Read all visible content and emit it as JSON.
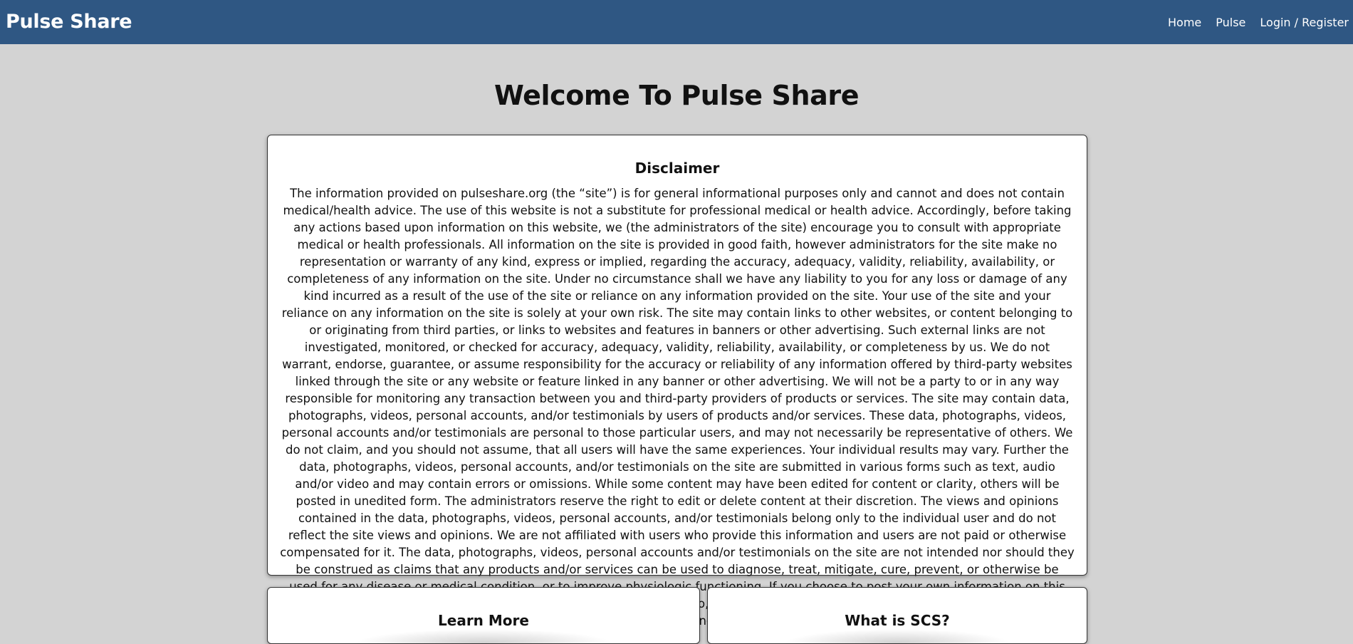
{
  "navbar": {
    "brand": "Pulse Share",
    "links": [
      "Home",
      "Pulse",
      "Login / Register"
    ]
  },
  "page": {
    "title": "Welcome To Pulse Share"
  },
  "disclaimer": {
    "heading": "Disclaimer",
    "body": "The information provided on pulseshare.org (the “site”) is for general informational purposes only and cannot and does not contain medical/health advice. The use of this website is not a substitute for professional medical or health advice. Accordingly, before taking any actions based upon information on this website, we (the administrators of the site) encourage you to consult with appropriate medical or health professionals. All information on the site is provided in good faith, however administrators for the site make no representation or warranty of any kind, express or implied, regarding the accuracy, adequacy, validity, reliability, availability, or completeness of any information on the site. Under no circumstance shall we have any liability to you for any loss or damage of any kind incurred as a result of the use of the site or reliance on any information provided on the site. Your use of the site and your reliance on any information on the site is solely at your own risk. The site may contain links to other websites, or content belonging to or originating from third parties, or links to websites and features in banners or other advertising. Such external links are not investigated, monitored, or checked for accuracy, adequacy, validity, reliability, availability, or completeness by us. We do not warrant, endorse, guarantee, or assume responsibility for the accuracy or reliability of any information offered by third-party websites linked through the site or any website or feature linked in any banner or other advertising. We will not be a party to or in any way responsible for monitoring any transaction between you and third-party providers of products or services. The site may contain data, photographs, videos, personal accounts, and/or testimonials by users of products and/or services. These data, photographs, videos, personal accounts and/or testimonials are personal to those particular users, and may not necessarily be representative of others. We do not claim, and you should not assume, that all users will have the same experiences. Your individual results may vary. Further the data, photographs, videos, personal accounts, and/or testimonials on the site are submitted in various forms such as text, audio and/or video and may contain errors or omissions. While some content may have been edited for content or clarity, others will be posted in unedited form. The administrators reserve the right to edit or delete content at their discretion. The views and opinions contained in the data, photographs, videos, personal accounts, and/or testimonials belong only to the individual user and do not reflect the site views and opinions. We are not affiliated with users who provide this information and users are not paid or otherwise compensated for it. The data, photographs, videos, personal accounts and/or testimonials on the site are not intended nor should they be construed as claims that any products and/or services can be used to diagnose, treat, mitigate, cure, prevent, or otherwise be used for any disease or medical condition, or to improve physiologic functioning. If you choose to post your own information on this website including data, experiences, photographs, testimonials or video, you acknowledge that you are posting it into a public domain where it will be freely available to anyone who can access the internet."
  },
  "cards": {
    "learn_more": "Learn More",
    "what_is_scs": "What is SCS?"
  }
}
